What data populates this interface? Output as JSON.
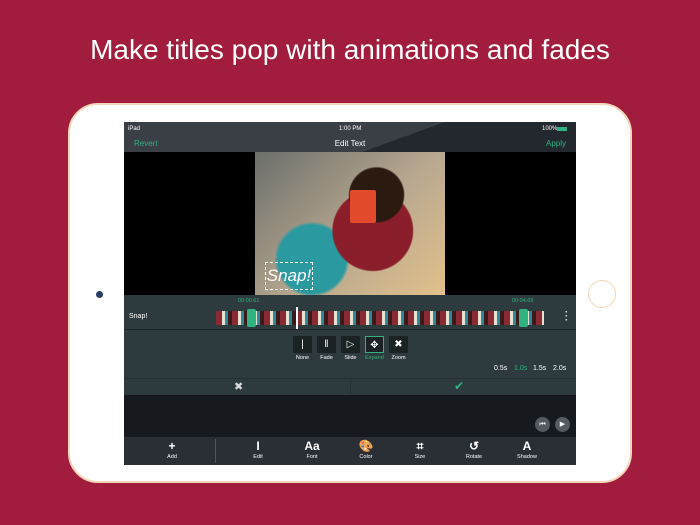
{
  "headline": "Make titles pop with animations and fades",
  "status": {
    "device": "iPad",
    "time": "1:00 PM",
    "battery": "100%"
  },
  "nav": {
    "revert": "Revert",
    "title": "Edit Text",
    "apply": "Apply"
  },
  "video": {
    "caption": "Snap!"
  },
  "timeline": {
    "label": "Snap!",
    "start": "00:00.61",
    "end": "00:04.65"
  },
  "transitions": [
    {
      "label": "None",
      "icon": "none-icon",
      "glyph": "|",
      "selected": false
    },
    {
      "label": "Fade",
      "icon": "fade-icon",
      "glyph": "‖",
      "selected": false
    },
    {
      "label": "Slide",
      "icon": "slide-icon",
      "glyph": "▷",
      "selected": false
    },
    {
      "label": "Expand",
      "icon": "expand-icon",
      "glyph": "✥",
      "selected": true
    },
    {
      "label": "Zoom",
      "icon": "zoom-icon",
      "glyph": "✖",
      "selected": false
    }
  ],
  "durations": [
    {
      "label": "0.5s",
      "selected": false
    },
    {
      "label": "1.0s",
      "selected": true
    },
    {
      "label": "1.5s",
      "selected": false
    },
    {
      "label": "2.0s",
      "selected": false
    }
  ],
  "actions": {
    "cancel": "✖",
    "confirm": "✔"
  },
  "playback": {
    "rewind": "⏮",
    "play": "▶"
  },
  "toolbar": [
    {
      "label": "Add",
      "glyph": "+"
    },
    {
      "label": "Edit",
      "glyph": "I"
    },
    {
      "label": "Font",
      "glyph": "Aa"
    },
    {
      "label": "Color",
      "glyph": "🎨"
    },
    {
      "label": "Size",
      "glyph": "⌗"
    },
    {
      "label": "Rotate",
      "glyph": "↺"
    },
    {
      "label": "Shadow",
      "glyph": "A"
    }
  ],
  "colors": {
    "background": "#a21d3d",
    "accent": "#2fb380"
  }
}
